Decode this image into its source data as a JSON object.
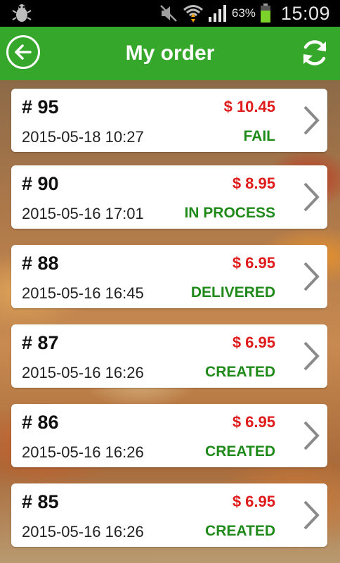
{
  "status_bar": {
    "battery_percent": "63%",
    "time": "15:09",
    "icons": [
      "debug-bug-icon",
      "mute-icon",
      "wifi-icon",
      "signal-icon",
      "battery-icon"
    ]
  },
  "app_bar": {
    "title": "My order",
    "back_icon": "back-arrow-icon",
    "refresh_icon": "refresh-icon",
    "color": "#35a72a"
  },
  "orders": [
    {
      "number": "# 95",
      "price": "$ 10.45",
      "date": "2015-05-18 10:27",
      "status": "FAIL"
    },
    {
      "number": "# 90",
      "price": "$ 8.95",
      "date": "2015-05-16 17:01",
      "status": "IN PROCESS"
    },
    {
      "number": "# 88",
      "price": "$ 6.95",
      "date": "2015-05-16 16:45",
      "status": "DELIVERED"
    },
    {
      "number": "# 87",
      "price": "$ 6.95",
      "date": "2015-05-16 16:26",
      "status": "CREATED"
    },
    {
      "number": "# 86",
      "price": "$ 6.95",
      "date": "2015-05-16 16:26",
      "status": "CREATED"
    },
    {
      "number": "# 85",
      "price": "$ 6.95",
      "date": "2015-05-16 16:26",
      "status": "CREATED"
    }
  ],
  "colors": {
    "price": "#e01b1b",
    "status": "#1f8a1a"
  }
}
